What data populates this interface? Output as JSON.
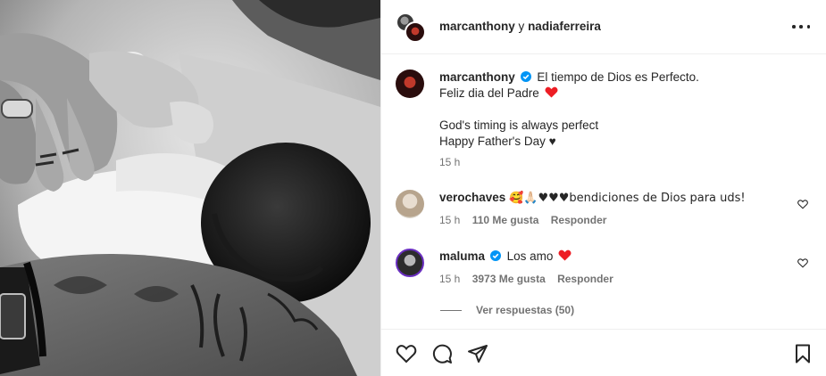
{
  "header": {
    "user1": "marcanthony",
    "connector": "y",
    "user2": "nadiaferreira"
  },
  "caption": {
    "username": "marcanthony",
    "line1": "El tiempo de Dios es Perfecto.",
    "line2": "Feliz dia del Padre",
    "line3": "God's timing is always perfect",
    "line4": "Happy Father's Day ♥",
    "time": "15 h"
  },
  "comments": [
    {
      "username": "verochaves",
      "text": "🥰🙏🏻♥♥♥bendiciones de Dios para uds!",
      "time": "15 h",
      "likes": "110 Me gusta",
      "reply": "Responder"
    },
    {
      "username": "maluma",
      "text": "Los amo",
      "time": "15 h",
      "likes": "3973 Me gusta",
      "reply": "Responder"
    }
  ],
  "view_replies": "Ver respuestas (50)",
  "icons": {
    "verified_color": "#0095f6",
    "heart_color": "#ed1d24",
    "story_ring_color": "#6a2fc0"
  }
}
